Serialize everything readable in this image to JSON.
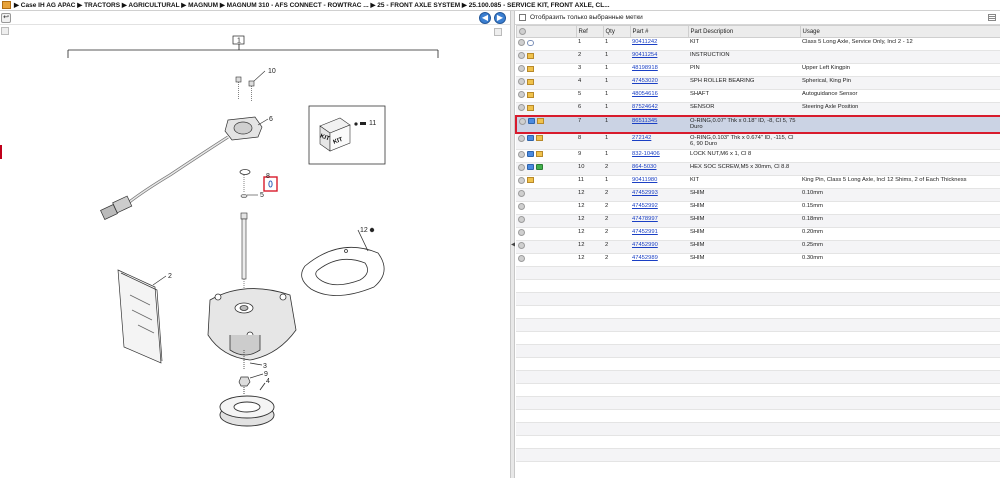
{
  "breadcrumb": {
    "text": "▶ Case IH AG APAC  ▶ TRACTORS  ▶ AGRICULTURAL  ▶ MAGNUM  ▶ MAGNUM 310 - AFS CONNECT - ROWTRAC ...  ▶ 25 - FRONT AXLE SYSTEM  ▶ 25.100.085 - SERVICE KIT, FRONT AXLE, CL..."
  },
  "toolbar": {
    "back_glyph": "↩",
    "prev_glyph": "◀",
    "next_glyph": "▶"
  },
  "filter": {
    "label": "Отобразить только выбранные метки"
  },
  "diagram": {
    "callouts": [
      "1",
      "10",
      "6",
      "11",
      "8",
      "5",
      "2",
      "12",
      "3",
      "9",
      "4"
    ],
    "kit_label": "KIT"
  },
  "table": {
    "headers": [
      "",
      "Ref",
      "Qty",
      "Part #",
      "Part Description",
      "Usage"
    ],
    "rows": [
      {
        "icons": [
          "circle",
          "link"
        ],
        "ref": "1",
        "qty": "1",
        "part": "90411242",
        "desc": "KIT",
        "usage": "Class 5 Long Axle, Service Only, Incl 2 - 12"
      },
      {
        "icons": [
          "circle",
          "box"
        ],
        "ref": "2",
        "qty": "1",
        "part": "90411254",
        "desc": "INSTRUCTION",
        "usage": ""
      },
      {
        "icons": [
          "circle",
          "box"
        ],
        "ref": "3",
        "qty": "1",
        "part": "48198918",
        "desc": "PIN",
        "usage": "Upper Left Kingpin"
      },
      {
        "icons": [
          "circle",
          "box"
        ],
        "ref": "4",
        "qty": "1",
        "part": "47453020",
        "desc": "SPH ROLLER BEARING",
        "usage": "Spherical, King Pin"
      },
      {
        "icons": [
          "circle",
          "box"
        ],
        "ref": "5",
        "qty": "1",
        "part": "48054616",
        "desc": "SHAFT",
        "usage": "Autoguidance Sensor"
      },
      {
        "icons": [
          "circle",
          "box"
        ],
        "ref": "6",
        "qty": "1",
        "part": "87524642",
        "desc": "SENSOR",
        "usage": "Steering Axle Position"
      },
      {
        "icons": [
          "circle",
          "blue",
          "box"
        ],
        "ref": "7",
        "qty": "1",
        "part": "86511345",
        "desc": "O-RING,0.07\" Thk x 0.18\" ID, -8, Cl 5, 75 Duro",
        "usage": "",
        "selected": true
      },
      {
        "icons": [
          "circle",
          "blue",
          "box"
        ],
        "ref": "8",
        "qty": "1",
        "part": "272142",
        "desc": "O-RING,0.103\" Thk x 0.674\" ID, -115, Cl 6, 90 Duro",
        "usage": ""
      },
      {
        "icons": [
          "circle",
          "blue",
          "box"
        ],
        "ref": "9",
        "qty": "1",
        "part": "832-10406",
        "desc": "LOCK NUT,M6 x 1, Cl 8",
        "usage": ""
      },
      {
        "icons": [
          "circle",
          "blue",
          "green"
        ],
        "ref": "10",
        "qty": "2",
        "part": "864-5030",
        "desc": "HEX SOC SCREW,M5 x 30mm, Cl 8.8",
        "usage": ""
      },
      {
        "icons": [
          "circle",
          "box"
        ],
        "ref": "11",
        "qty": "1",
        "part": "90411980",
        "desc": "KIT",
        "usage": "King Pin, Class 5 Long Axle, Incl 12 Shims, 2 of Each Thickness"
      },
      {
        "icons": [
          "circle"
        ],
        "ref": "12",
        "qty": "2",
        "part": "47452993",
        "desc": "SHIM",
        "usage": "0.10mm"
      },
      {
        "icons": [
          "circle"
        ],
        "ref": "12",
        "qty": "2",
        "part": "47452992",
        "desc": "SHIM",
        "usage": "0.15mm"
      },
      {
        "icons": [
          "circle"
        ],
        "ref": "12",
        "qty": "2",
        "part": "47478997",
        "desc": "SHIM",
        "usage": "0.18mm"
      },
      {
        "icons": [
          "circle"
        ],
        "ref": "12",
        "qty": "2",
        "part": "47452991",
        "desc": "SHIM",
        "usage": "0.20mm"
      },
      {
        "icons": [
          "circle"
        ],
        "ref": "12",
        "qty": "2",
        "part": "47452990",
        "desc": "SHIM",
        "usage": "0.25mm"
      },
      {
        "icons": [
          "circle"
        ],
        "ref": "12",
        "qty": "2",
        "part": "47452989",
        "desc": "SHIM",
        "usage": "0.30mm"
      }
    ]
  },
  "colors": {
    "selection_border": "#d81b2c",
    "selection_fill": "#cbd3e4",
    "link": "#1a3fc4"
  }
}
